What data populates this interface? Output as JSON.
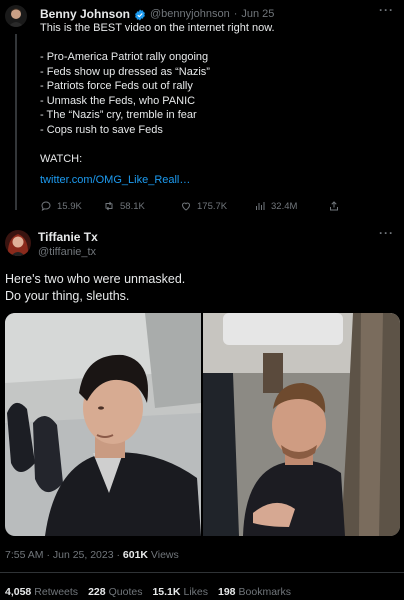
{
  "tweet1": {
    "author_name": "Benny Johnson",
    "handle": "@bennyjohnson",
    "separator": "·",
    "date": "Jun 25",
    "lines": [
      "This is the BEST video on the internet right now.",
      "",
      "- Pro-America Patriot rally ongoing",
      "- Feds show up dressed as “Nazis”",
      "- Patriots force Feds out of rally",
      "- Unmask the Feds, who PANIC",
      "- The “Nazis” cry, tremble in fear",
      "- Cops rush to save Feds",
      "",
      "WATCH:"
    ],
    "link": "twitter.com/OMG_Like_Reall…",
    "stats": {
      "replies": "15.9K",
      "retweets": "58.1K",
      "likes": "175.7K",
      "views": "32.4M"
    }
  },
  "tweet2": {
    "author_name": "Tiffanie Tx",
    "handle": "@tiffanie_tx",
    "text_line1": "Here's two who were unmasked.",
    "text_line2": "Do your thing, sleuths.",
    "meta": {
      "time_date": "7:55 AM · Jun 25, 2023 · ",
      "views_count": "601K",
      "views_label": " Views"
    },
    "engagement": [
      {
        "count": "4,058",
        "label": "Retweets"
      },
      {
        "count": "228",
        "label": "Quotes"
      },
      {
        "count": "15.1K",
        "label": "Likes"
      },
      {
        "count": "198",
        "label": "Bookmarks"
      }
    ]
  },
  "more_menu": "···",
  "colors": {
    "background": "#000000",
    "text": "#e7e9ea",
    "muted": "#71767b",
    "link": "#1d9bf0",
    "verified": "#1d9bf0",
    "divider": "#2f3336"
  },
  "icons": [
    "reply-icon",
    "retweet-icon",
    "like-icon",
    "views-icon",
    "share-icon",
    "verified-badge-icon",
    "more-icon"
  ]
}
